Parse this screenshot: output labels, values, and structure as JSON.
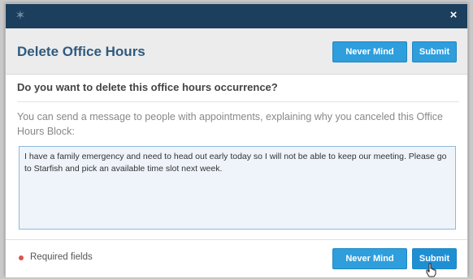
{
  "titlebar": {
    "logo_icon": "starfish-logo-icon",
    "close_icon": "close-icon",
    "close_glyph": "×"
  },
  "dialog": {
    "title": "Delete Office Hours",
    "question": "Do you want to delete this office hours occurrence?",
    "instructions": "You can send a message to people with appointments, explaining why you canceled this Office Hours Block:",
    "message_value": "I have a family emergency and need to head out early today so I will not be able to keep our meeting. Please go to Starfish and pick an available time slot next week."
  },
  "header_buttons": {
    "never_mind": "Never Mind",
    "submit": "Submit"
  },
  "footer": {
    "required_label": "Required fields",
    "never_mind": "Never Mind",
    "submit": "Submit"
  },
  "colors": {
    "titlebar": "#1d3f5e",
    "title_text": "#2f5a7e",
    "button": "#2e9edd",
    "required_dot": "#d9534f"
  }
}
